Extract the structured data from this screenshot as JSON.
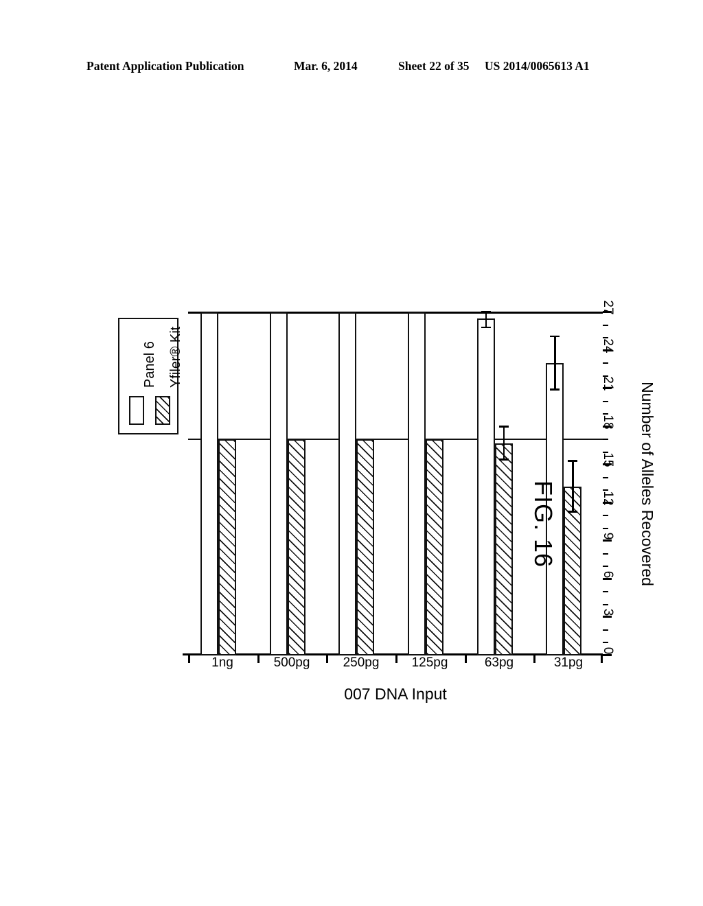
{
  "header": {
    "publication": "Patent Application Publication",
    "date": "Mar. 6, 2014",
    "sheet": "Sheet 22 of 35",
    "patent_number": "US 2014/0065613 A1"
  },
  "figure": {
    "caption": "FIG. 16"
  },
  "legend": {
    "items": [
      {
        "label": "Panel 6",
        "pattern": "solid-white",
        "swatch_name": "legend-swatch-panel6"
      },
      {
        "label": "Yfiler® Kit",
        "pattern": "diagonal-hatch",
        "swatch_name": "legend-swatch-yfiler"
      }
    ]
  },
  "chart_data": {
    "type": "bar",
    "orientation": "vertical-rendered-rotated",
    "title": "",
    "xlabel": "007 DNA Input",
    "ylabel": "Number of Alleles Recovered",
    "categories": [
      "1ng",
      "500pg",
      "250pg",
      "125pg",
      "63pg",
      "31pg"
    ],
    "ylim": [
      0,
      27
    ],
    "yticks": [
      0,
      3,
      6,
      9,
      12,
      15,
      18,
      21,
      24,
      27
    ],
    "ytick_labels": [
      "0",
      "3",
      "6",
      "9",
      "12",
      "15",
      "18",
      "21",
      "24",
      "27"
    ],
    "minor_ticks_per_interval": 2,
    "grid": false,
    "legend_position": "top-right",
    "series": [
      {
        "name": "Panel 6",
        "pattern": "solid-white",
        "values": [
          27,
          27,
          27,
          27,
          26.5,
          23.0
        ],
        "errors": [
          0,
          0,
          0,
          0,
          0.7,
          2.1
        ]
      },
      {
        "name": "Yfiler® Kit",
        "pattern": "diagonal-hatch",
        "values": [
          17,
          17,
          17,
          17,
          16.7,
          13.3
        ],
        "errors": [
          0,
          0,
          0,
          0,
          1.3,
          2.0
        ]
      }
    ]
  }
}
